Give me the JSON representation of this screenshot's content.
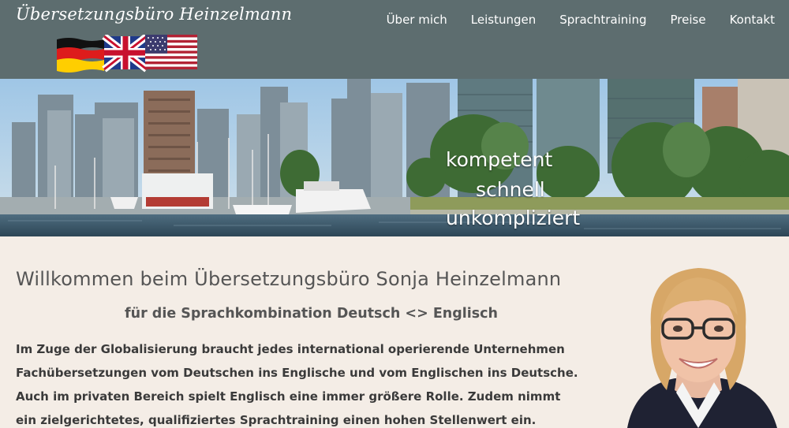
{
  "site": {
    "logo_text": "Übersetzungsbüro Heinzelmann",
    "flags": [
      "german-flag-icon",
      "uk-flag-icon",
      "us-flag-icon"
    ]
  },
  "nav": {
    "items": [
      {
        "label": "Über mich"
      },
      {
        "label": "Leistungen"
      },
      {
        "label": "Sprachtraining"
      },
      {
        "label": "Preise"
      },
      {
        "label": "Kontakt"
      }
    ]
  },
  "hero": {
    "taglines": [
      "kompetent",
      "schnell",
      "unkompliziert"
    ]
  },
  "main": {
    "heading": "Willkommen beim Übersetzungsbüro Sonja Heinzelmann",
    "subheading": "für die Sprachkombination Deutsch <> Englisch",
    "intro": "Im Zuge der Globalisierung braucht jedes international operierende Unternehmen Fachübersetzungen vom Deutschen ins Englische und vom Englischen ins Deutsche. Auch im privaten Bereich spielt Englisch eine immer größere Rolle. Zudem nimmt ein zielgerichtetes, qualifiziertes Sprachtraining einen hohen Stellenwert ein."
  },
  "colors": {
    "header_bg": "#5d6d6f",
    "content_bg": "#f4ede6",
    "text": "#3a3a3a"
  }
}
